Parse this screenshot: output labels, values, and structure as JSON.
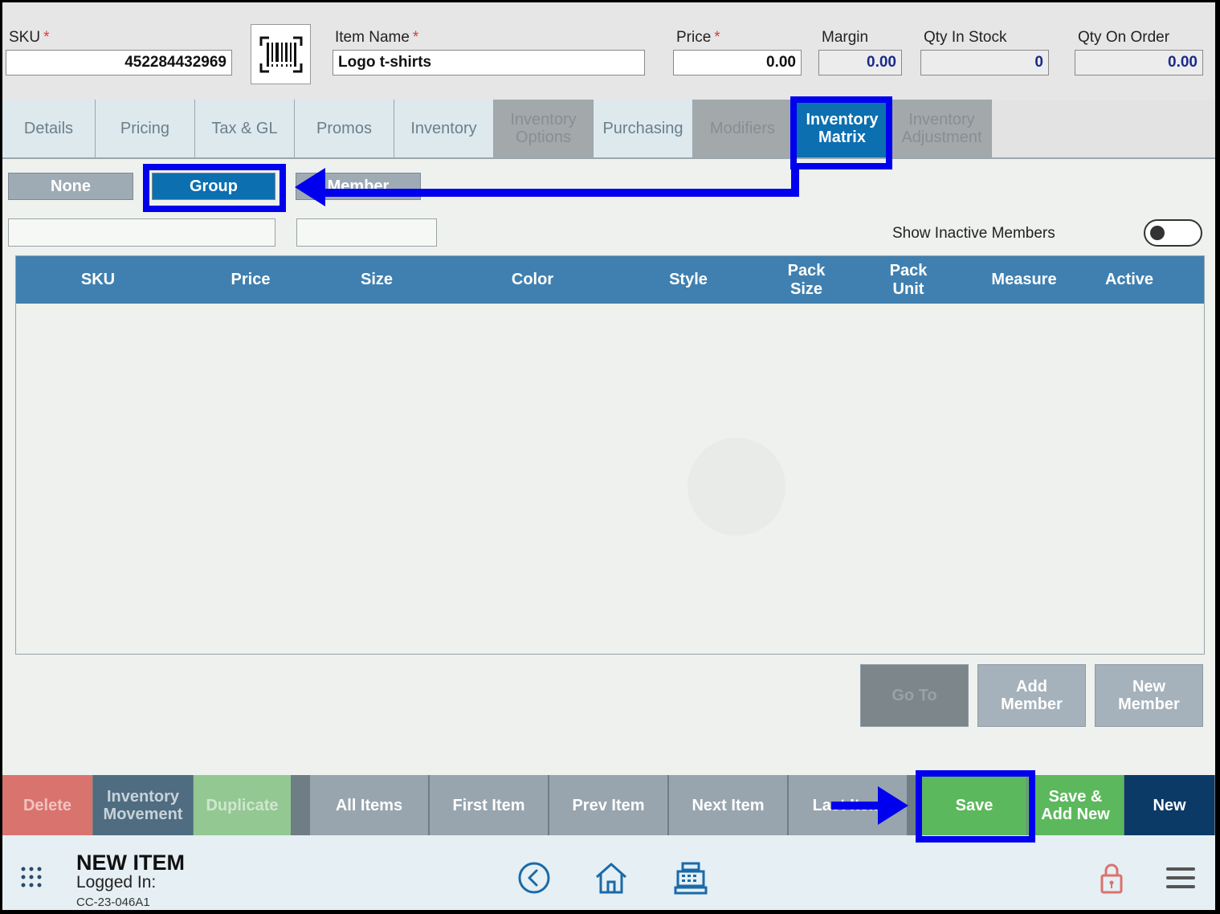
{
  "header": {
    "sku_label": "SKU",
    "sku_value": "452284432969",
    "item_name_label": "Item Name",
    "item_name_value": "Logo t-shirts",
    "price_label": "Price",
    "price_value": "0.00",
    "margin_label": "Margin",
    "margin_value": "0.00",
    "qty_in_stock_label": "Qty In Stock",
    "qty_in_stock_value": "0",
    "qty_on_order_label": "Qty On Order",
    "qty_on_order_value": "0.00",
    "required_marker": "*"
  },
  "tabs": [
    {
      "label": "Details",
      "state": "normal"
    },
    {
      "label": "Pricing",
      "state": "normal"
    },
    {
      "label": "Tax & GL",
      "state": "normal"
    },
    {
      "label": "Promos",
      "state": "normal"
    },
    {
      "label": "Inventory",
      "state": "normal"
    },
    {
      "label": "Inventory Options",
      "state": "disabled"
    },
    {
      "label": "Purchasing",
      "state": "normal"
    },
    {
      "label": "Modifiers",
      "state": "disabled"
    },
    {
      "label": "Inventory Matrix",
      "state": "active"
    },
    {
      "label": "Inventory Adjustment",
      "state": "disabled"
    }
  ],
  "matrix_modes": {
    "none": "None",
    "group": "Group",
    "member": "Member",
    "selected": "Group"
  },
  "show_inactive": {
    "label": "Show Inactive Members",
    "on": false
  },
  "table": {
    "columns": [
      "SKU",
      "Price",
      "Size",
      "Color",
      "Style",
      "Pack Size",
      "Pack Unit",
      "Measure",
      "Active"
    ],
    "rows": []
  },
  "matrix_actions": {
    "go_to": "Go To",
    "add_member": "Add Member",
    "new_member": "New Member"
  },
  "action_bar": {
    "delete": "Delete",
    "inventory_movement": "Inventory Movement",
    "duplicate": "Duplicate",
    "all_items": "All Items",
    "first_item": "First Item",
    "prev_item": "Prev Item",
    "next_item": "Next Item",
    "last_item": "Last Item",
    "save": "Save",
    "save_add_new": "Save & Add New",
    "new": "New"
  },
  "footer": {
    "title": "NEW ITEM",
    "logged_in": "Logged In:",
    "terminal_code": "CC-23-046A1"
  },
  "icons": [
    "barcode-icon",
    "grid-menu-icon",
    "back-icon",
    "home-icon",
    "register-icon",
    "lock-icon",
    "hamburger-menu-icon"
  ],
  "colors": {
    "accent": "#0b6fb0",
    "table_header": "#4080b0",
    "save": "#5cb85c",
    "delete": "#d9736e",
    "new": "#0b3a66",
    "annotation": "#0000ee"
  }
}
